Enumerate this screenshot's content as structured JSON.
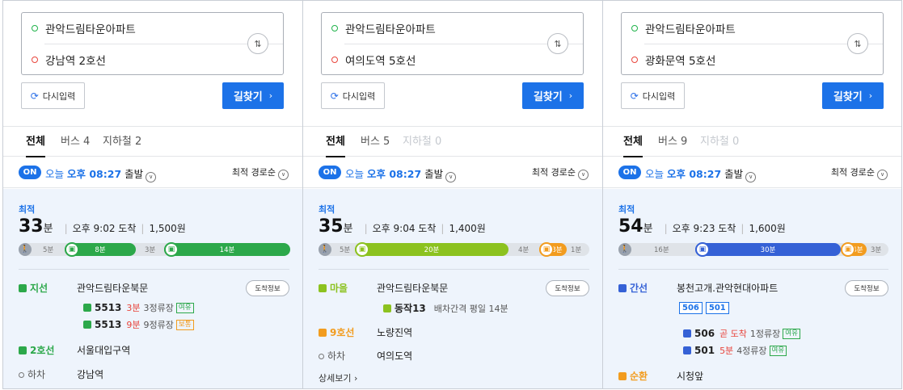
{
  "colors": {
    "accent": "#1c72e8",
    "green": "#2ca84a",
    "lime": "#8cc21f",
    "orange": "#f29c1f",
    "red": "#e8453c",
    "blue_bus": "#3561d6"
  },
  "panels": [
    {
      "origin": "관악드림타운아파트",
      "destination": "강남역 2호선",
      "reset_label": "다시입력",
      "find_label": "길찾기",
      "tabs": [
        {
          "label": "전체"
        },
        {
          "label": "버스 4"
        },
        {
          "label": "지하철 2"
        }
      ],
      "on_label": "ON",
      "time_prefix": "오늘",
      "time_value": "오후 08:27",
      "time_suffix": "출발",
      "sort_label": "최적 경로순",
      "best_label": "최적",
      "duration": "33",
      "duration_unit": "분",
      "arrival": "오후 9:02 도착",
      "fare": "1,500원",
      "bar_labels": {
        "walk1": "5분",
        "ride1": "8분",
        "walk2": "3분",
        "ride2": "14분"
      },
      "steps": [
        {
          "mode": "지선",
          "place": "관악드림타운북문"
        },
        {
          "mode": "2호선",
          "place": "서울대입구역"
        },
        {
          "mode": "하차",
          "place": "강남역"
        }
      ],
      "info_label": "도착정보",
      "buses": [
        {
          "no": "5513",
          "eta": "3분",
          "stops": "3정류장",
          "tag": "여유"
        },
        {
          "no": "5513",
          "eta": "9분",
          "stops": "9정류장",
          "tag": "보통"
        }
      ]
    },
    {
      "origin": "관악드림타운아파트",
      "destination": "여의도역 5호선",
      "reset_label": "다시입력",
      "find_label": "길찾기",
      "tabs": [
        {
          "label": "전체"
        },
        {
          "label": "버스 5"
        },
        {
          "label": "지하철 0"
        }
      ],
      "on_label": "ON",
      "time_prefix": "오늘",
      "time_value": "오후 08:27",
      "time_suffix": "출발",
      "sort_label": "최적 경로순",
      "best_label": "최적",
      "duration": "35",
      "duration_unit": "분",
      "arrival": "오후 9:04 도착",
      "fare": "1,400원",
      "bar_labels": {
        "walk1": "5분",
        "ride1": "20분",
        "walk2": "4분",
        "ride2": "3분",
        "walk3": "1분"
      },
      "steps": [
        {
          "mode": "마을",
          "place": "관악드림타운북문"
        },
        {
          "mode": "9호선",
          "place": "노량진역"
        },
        {
          "mode": "하차",
          "place": "여의도역"
        }
      ],
      "info_label": "도착정보",
      "buses": [
        {
          "no": "동작13",
          "note": "배차간격 평일 14분"
        }
      ],
      "more_label": "상세보기"
    },
    {
      "origin": "관악드림타운아파트",
      "destination": "광화문역 5호선",
      "reset_label": "다시입력",
      "find_label": "길찾기",
      "tabs": [
        {
          "label": "전체"
        },
        {
          "label": "버스 9"
        },
        {
          "label": "지하철 0"
        }
      ],
      "on_label": "ON",
      "time_prefix": "오늘",
      "time_value": "오후 08:27",
      "time_suffix": "출발",
      "sort_label": "최적 경로순",
      "best_label": "최적",
      "duration": "54",
      "duration_unit": "분",
      "arrival": "오후 9:23 도착",
      "fare": "1,600원",
      "bar_labels": {
        "walk1": "16분",
        "ride1": "30분",
        "ride2": "4분",
        "walk3": "3분"
      },
      "steps": [
        {
          "mode": "간선",
          "place": "봉천고개.관악현대아파트"
        },
        {
          "mode": "순환",
          "place": "시청앞"
        }
      ],
      "info_label": "도착정보",
      "route_numbers": [
        "506",
        "501"
      ],
      "buses": [
        {
          "no": "506",
          "eta": "곧 도착",
          "stops": "1정류장",
          "tag": "여유"
        },
        {
          "no": "501",
          "eta": "5분",
          "stops": "4정류장",
          "tag": "여유"
        }
      ]
    }
  ]
}
